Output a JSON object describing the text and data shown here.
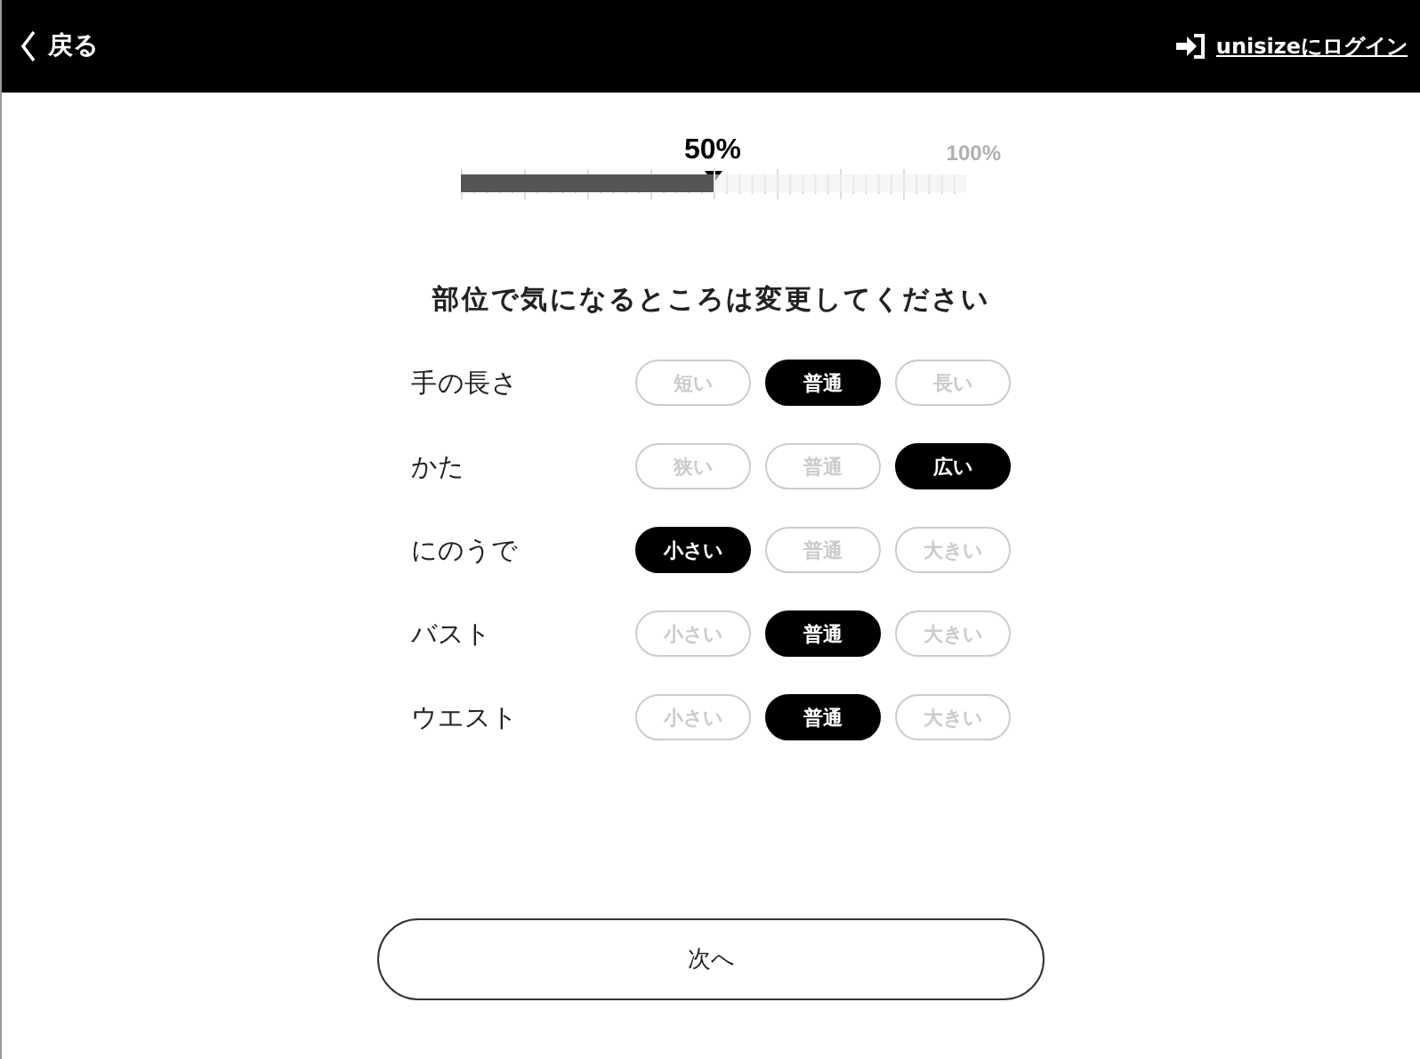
{
  "header": {
    "back_label": "戻る",
    "login_link": "unisizeにログイン"
  },
  "progress": {
    "level": 0.5,
    "reading": "50%",
    "end_label": "100%"
  },
  "heading": "部位で気になるところは変更してください",
  "rows": [
    {
      "label": "手の長さ",
      "options": [
        {
          "label": "短い",
          "selected": false
        },
        {
          "label": "普通",
          "selected": true
        },
        {
          "label": "長い",
          "selected": false
        }
      ]
    },
    {
      "label": "かた",
      "options": [
        {
          "label": "狭い",
          "selected": false
        },
        {
          "label": "普通",
          "selected": false
        },
        {
          "label": "広い",
          "selected": true
        }
      ]
    },
    {
      "label": "にのうで",
      "options": [
        {
          "label": "小さい",
          "selected": true
        },
        {
          "label": "普通",
          "selected": false
        },
        {
          "label": "大きい",
          "selected": false
        }
      ]
    },
    {
      "label": "バスト",
      "options": [
        {
          "label": "小さい",
          "selected": false
        },
        {
          "label": "普通",
          "selected": true
        },
        {
          "label": "大きい",
          "selected": false
        }
      ]
    },
    {
      "label": "ウエスト",
      "options": [
        {
          "label": "小さい",
          "selected": false
        },
        {
          "label": "普通",
          "selected": true
        },
        {
          "label": "大きい",
          "selected": false
        }
      ]
    }
  ],
  "next_button": "次へ"
}
